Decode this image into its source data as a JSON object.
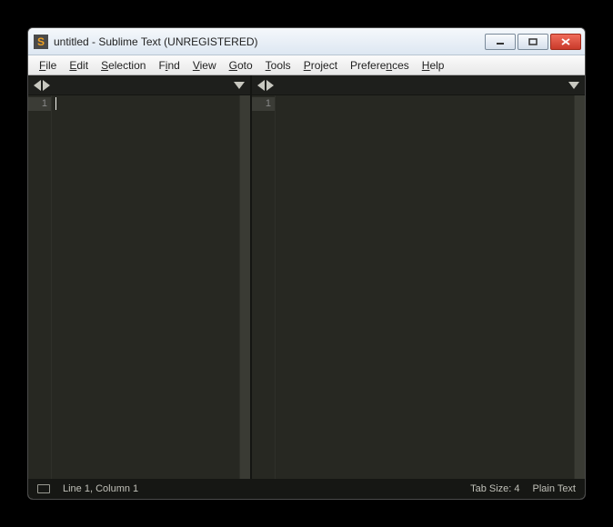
{
  "window": {
    "title": "untitled - Sublime Text (UNREGISTERED)"
  },
  "menubar": {
    "items": [
      {
        "label": "File",
        "accel": "F"
      },
      {
        "label": "Edit",
        "accel": "E"
      },
      {
        "label": "Selection",
        "accel": "S"
      },
      {
        "label": "Find",
        "accel": "i"
      },
      {
        "label": "View",
        "accel": "V"
      },
      {
        "label": "Goto",
        "accel": "G"
      },
      {
        "label": "Tools",
        "accel": "T"
      },
      {
        "label": "Project",
        "accel": "P"
      },
      {
        "label": "Preferences",
        "accel": "n"
      },
      {
        "label": "Help",
        "accel": "H"
      }
    ]
  },
  "panes": {
    "left": {
      "line_number": "1"
    },
    "right": {
      "line_number": "1"
    }
  },
  "statusbar": {
    "position": "Line 1, Column 1",
    "tab_size": "Tab Size: 4",
    "syntax": "Plain Text"
  }
}
